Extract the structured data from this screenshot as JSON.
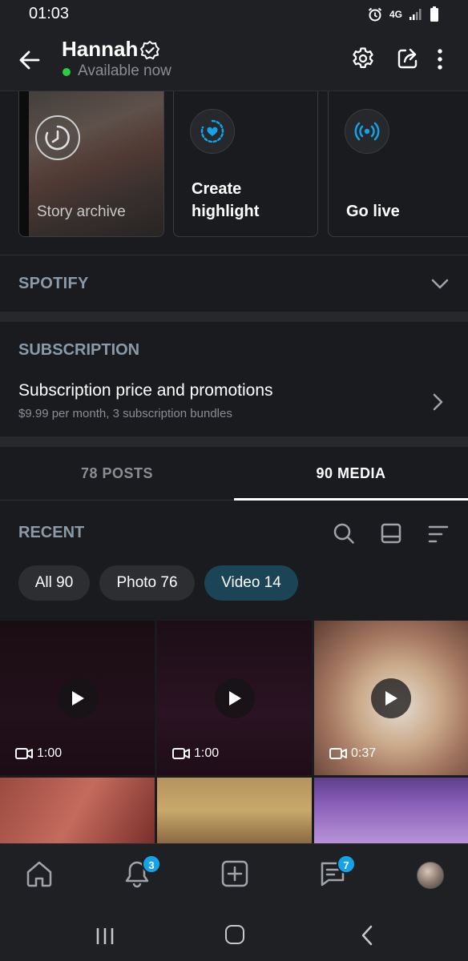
{
  "status_bar": {
    "time": "01:03",
    "network": "4G"
  },
  "header": {
    "name": "Hannah",
    "status": "Available now"
  },
  "highlights": [
    {
      "label": "Story archive"
    },
    {
      "label_line1": "Create",
      "label_line2": "highlight"
    },
    {
      "label": "Go live"
    }
  ],
  "spotify": {
    "title": "SPOTIFY"
  },
  "subscription": {
    "title": "SUBSCRIPTION",
    "row_title": "Subscription price and promotions",
    "row_subtitle": "$9.99 per month, 3 subscription bundles"
  },
  "tabs": {
    "posts": "78 POSTS",
    "media": "90 MEDIA"
  },
  "recent": {
    "title": "RECENT"
  },
  "filters": {
    "all": "All 90",
    "photo": "Photo 76",
    "video": "Video 14",
    "selected": "video"
  },
  "media": [
    {
      "duration": "1:00"
    },
    {
      "duration": "1:00"
    },
    {
      "duration": "0:37"
    }
  ],
  "bottom_nav": {
    "notifications_badge": "3",
    "messages_badge": "7"
  },
  "colors": {
    "accent": "#14a3e8",
    "chip_selected": "#1b4556",
    "online": "#2ecc40",
    "background": "#1a1b1e"
  }
}
